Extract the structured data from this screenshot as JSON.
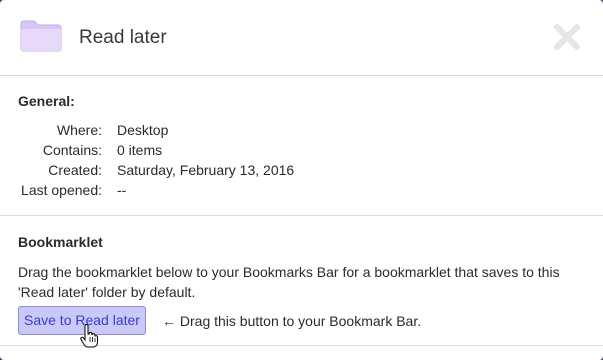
{
  "header": {
    "title": "Read later",
    "folder_icon": "folder-icon",
    "close_icon": "close-icon",
    "folder_color": "#e3d4f7"
  },
  "general": {
    "heading": "General:",
    "rows": [
      {
        "label": "Where:",
        "value": "Desktop"
      },
      {
        "label": "Contains:",
        "value": "0 items"
      },
      {
        "label": "Created:",
        "value": "Saturday, February 13, 2016"
      },
      {
        "label": "Last opened:",
        "value": "--"
      }
    ]
  },
  "bookmarklet": {
    "heading": "Bookmarklet",
    "description": "Drag the bookmarklet below to your Bookmarks Bar for a bookmarklet that saves to this 'Read later' folder by default.",
    "button_label": "Save to Read later",
    "hint": "← Drag this button to your Bookmark Bar.",
    "button_color": "#c9c9f7",
    "button_text_color": "#3a3ad0"
  },
  "cursor": "hand-pointer-icon"
}
